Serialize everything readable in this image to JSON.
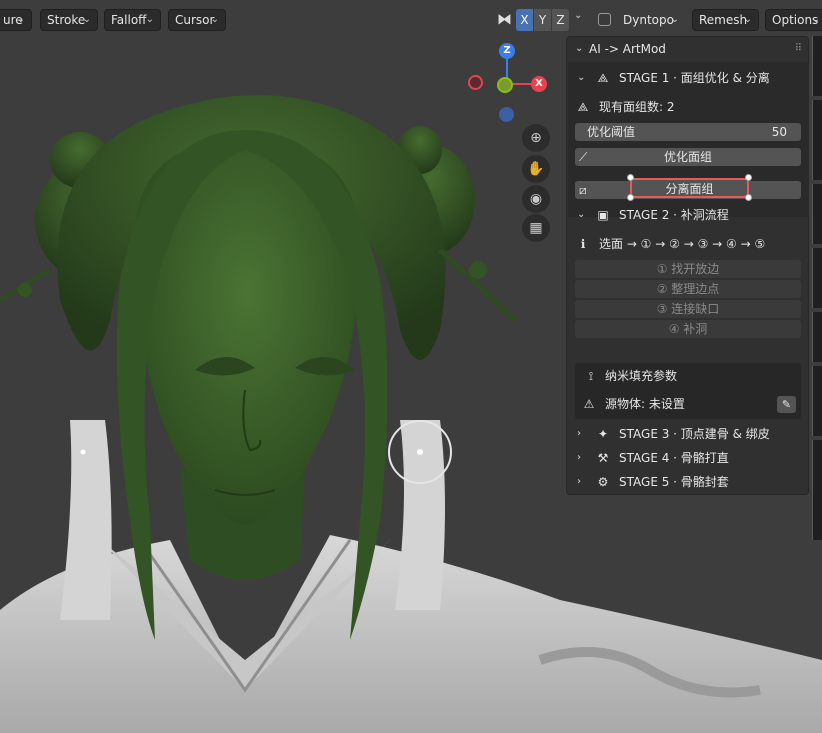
{
  "toolbar": {
    "menus": [
      {
        "label": "ure"
      },
      {
        "label": "Stroke"
      },
      {
        "label": "Falloff"
      },
      {
        "label": "Cursor"
      }
    ],
    "mirror_axes": [
      "X",
      "Y",
      "Z"
    ],
    "dyntopo_label": "Dyntopo",
    "remesh_label": "Remesh",
    "options_label": "Options"
  },
  "gizmo": {
    "x_label": "X",
    "z_label": "Z",
    "x_color": "#e8424f",
    "y_color": "#8bbd21",
    "z_color": "#3a7ee8"
  },
  "panel": {
    "title": "AI -> ArtMod",
    "stage1": {
      "title": "STAGE 1 · 面组优化 & 分离",
      "face_count_label": "现有面组数: 2",
      "threshold_label": "优化阈值",
      "threshold_value": "50",
      "optimize_button": "优化面组",
      "separate_button": "分离面组"
    },
    "stage2": {
      "title": "STAGE 2 · 补洞流程",
      "flow_label": "选面 → ① → ② → ③ → ④ → ⑤",
      "steps": [
        {
          "label": "① 找开放边"
        },
        {
          "label": "② 整理边点"
        },
        {
          "label": "③ 连接缺口"
        },
        {
          "label": "④ 补洞"
        }
      ],
      "nano_label": "纳米填充参数",
      "source_label": "源物体: 未设置"
    },
    "stage3_title": "STAGE 3 · 顶点建骨 & 绑皮",
    "stage4_title": "STAGE 4 · 骨骼打直",
    "stage5_title": "STAGE 5 · 骨骼封套"
  },
  "colors": {
    "accent": "#4772b3",
    "highlight": "#e85a5a",
    "sculpt_green": "#3d5e2b",
    "panel_bg": "#303030"
  }
}
